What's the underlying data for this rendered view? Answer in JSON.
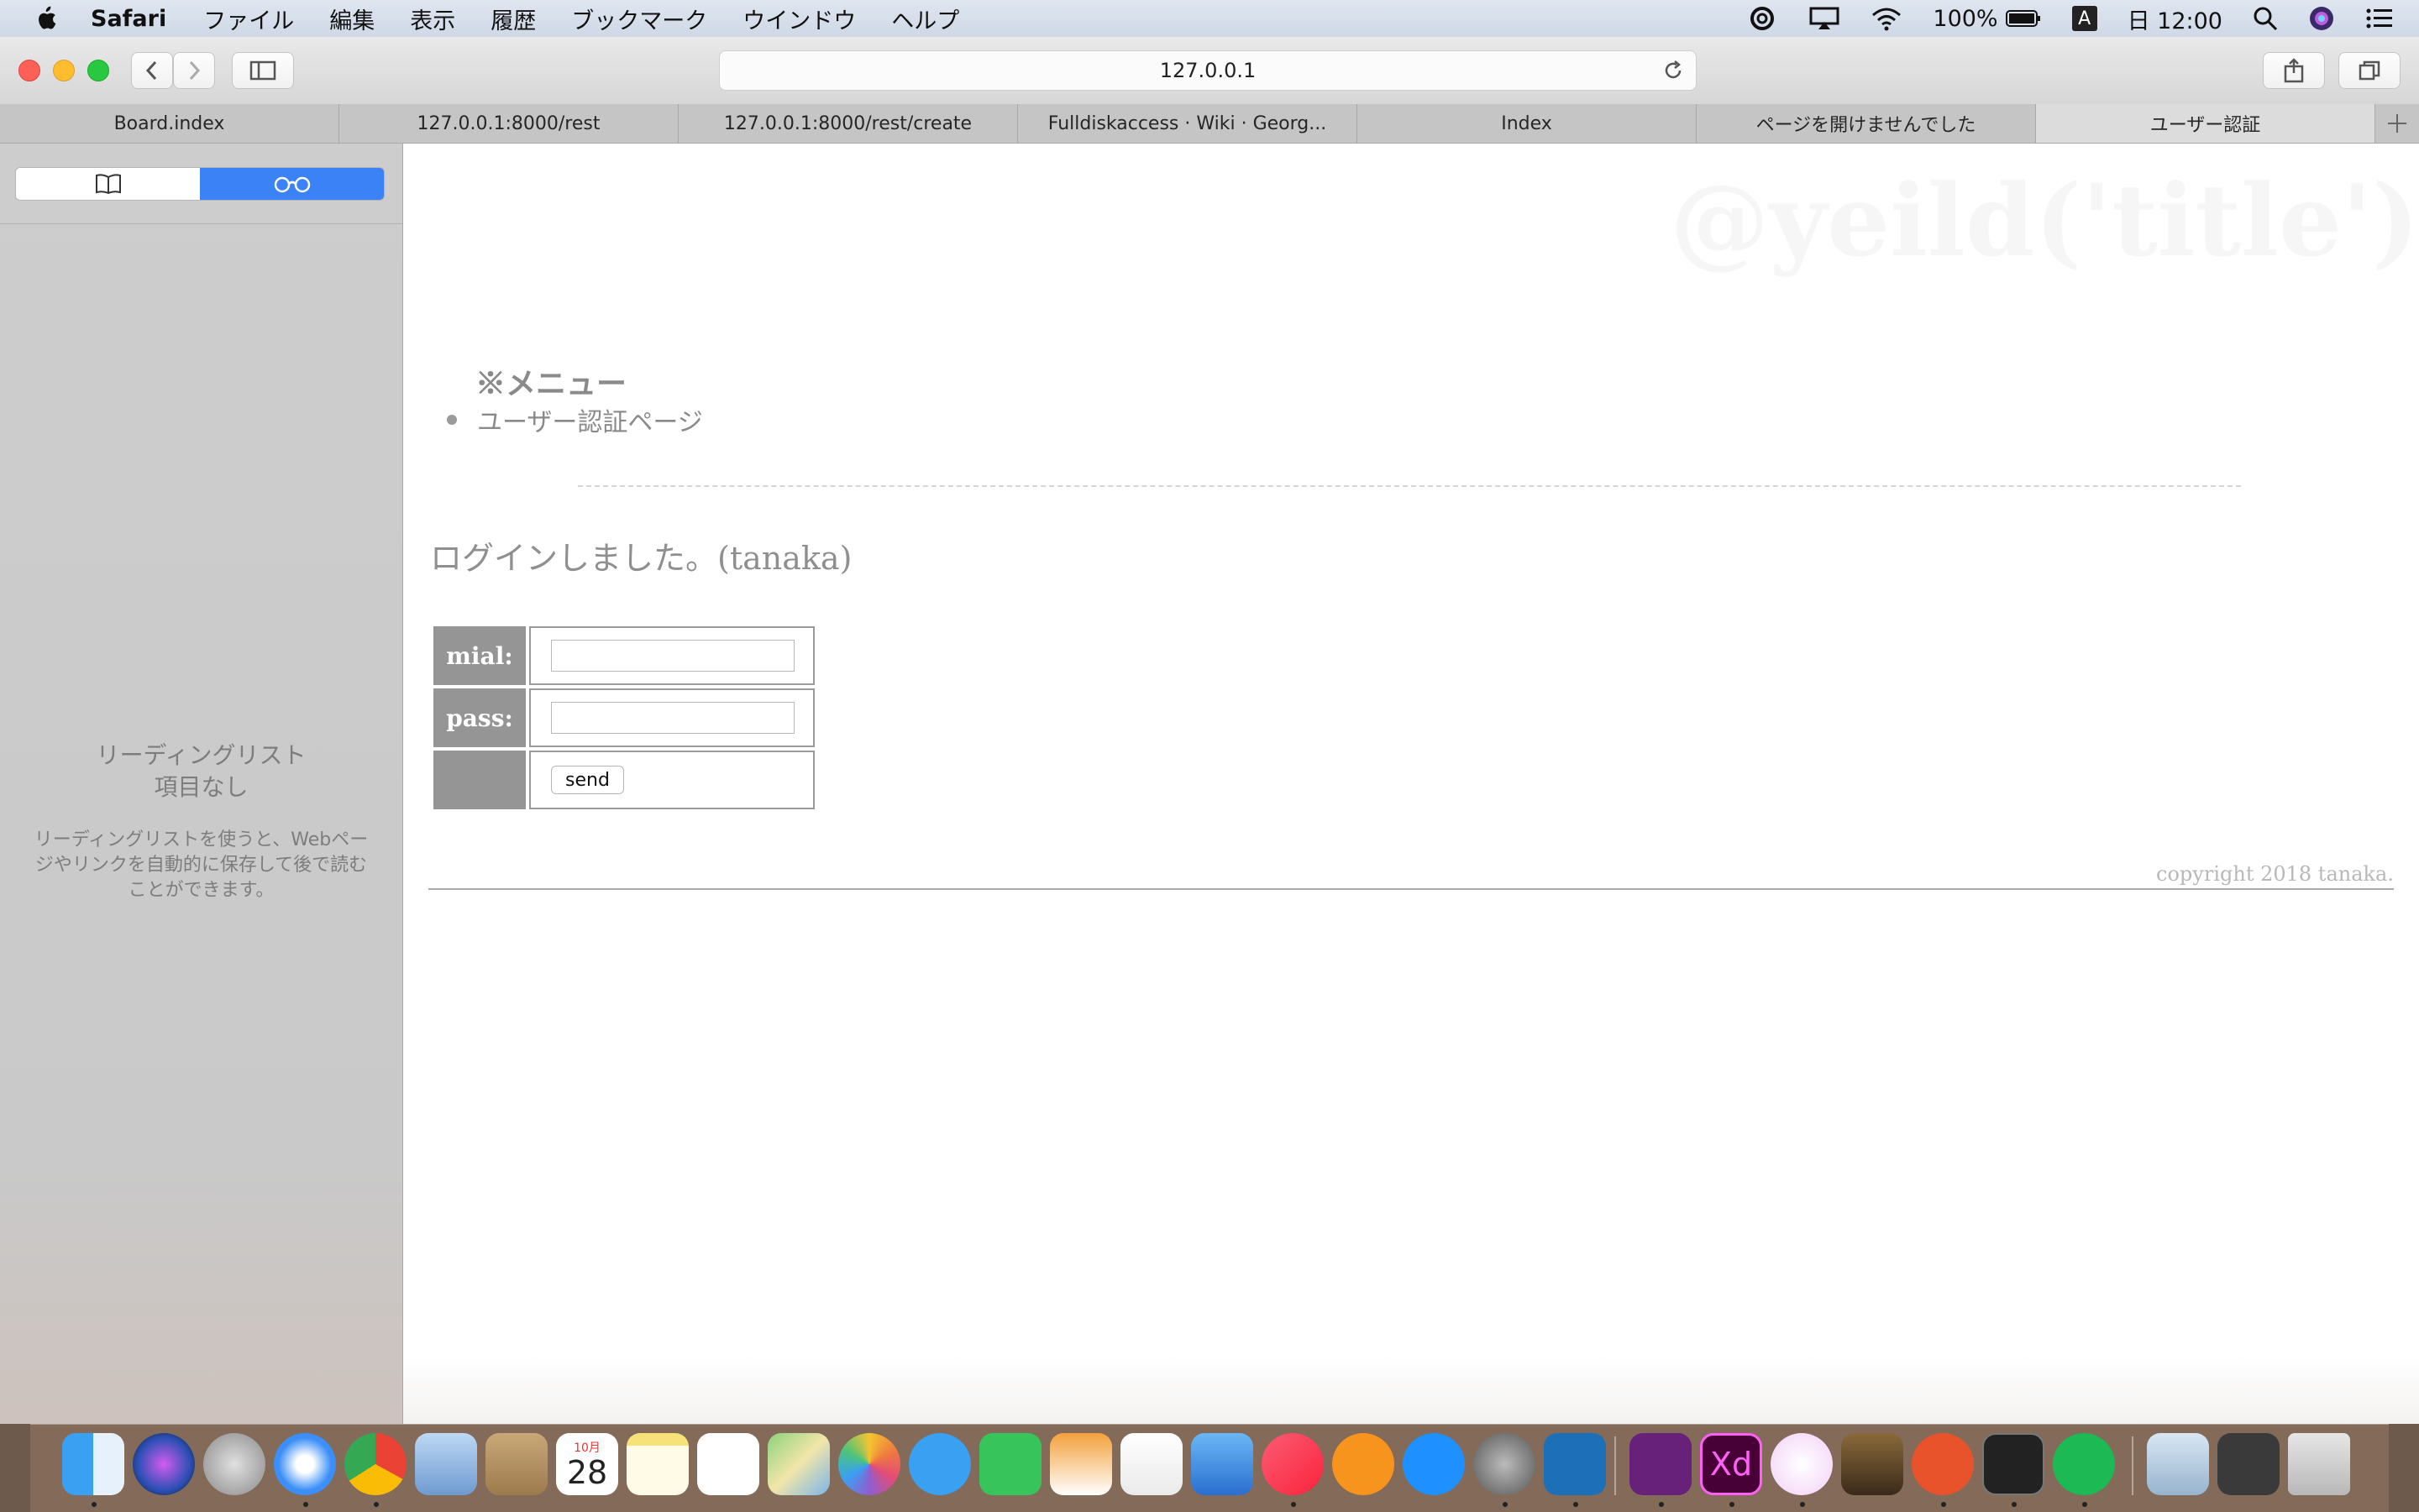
{
  "menubar": {
    "app_name": "Safari",
    "items": [
      "ファイル",
      "編集",
      "表示",
      "履歴",
      "ブックマーク",
      "ウインドウ",
      "ヘルプ"
    ],
    "battery": "100%",
    "input_mode": "A",
    "clock": "日 12:00"
  },
  "toolbar": {
    "url": "127.0.0.1"
  },
  "tabs": [
    {
      "label": "Board.index"
    },
    {
      "label": "127.0.0.1:8000/rest"
    },
    {
      "label": "127.0.0.1:8000/rest/create"
    },
    {
      "label": "Fulldiskaccess · Wiki · Georg..."
    },
    {
      "label": "Index"
    },
    {
      "label": "ページを開けませんでした"
    },
    {
      "label": "ユーザー認証"
    }
  ],
  "sidebar": {
    "empty_title_1": "リーディングリスト",
    "empty_title_2": "項目なし",
    "empty_desc": "リーディングリストを使うと、Webページやリンクを自動的に保存して後で読むことができます。"
  },
  "page": {
    "ghost_title": "@yeild('title')",
    "menu_heading": "※メニュー",
    "menu_items": [
      "ユーザー認証ページ"
    ],
    "login_message": "ログインしました。(tanaka)",
    "form": {
      "mail_label": "mial:",
      "pass_label": "pass:",
      "send_label": "send"
    },
    "copyright": "copyright 2018 tanaka."
  },
  "dock": {
    "calendar_month": "10月",
    "calendar_day": "28",
    "apps": [
      "finder",
      "siri",
      "launchpad",
      "safari",
      "chrome",
      "mail",
      "contacts",
      "calendar",
      "notes",
      "reminders",
      "maps",
      "photos",
      "messages",
      "facetime",
      "pages",
      "numbers",
      "keynote",
      "itunes",
      "books",
      "app-store",
      "system-preferences",
      "vscode",
      "visual-studio",
      "adobe-xd",
      "affinity",
      "garageband",
      "sequel",
      "terminal",
      "spotify",
      "downloads",
      "gpu-monitor",
      "trash"
    ]
  },
  "colors": {
    "selection_blue": "#3a82f6",
    "form_label_bg": "#959595"
  }
}
